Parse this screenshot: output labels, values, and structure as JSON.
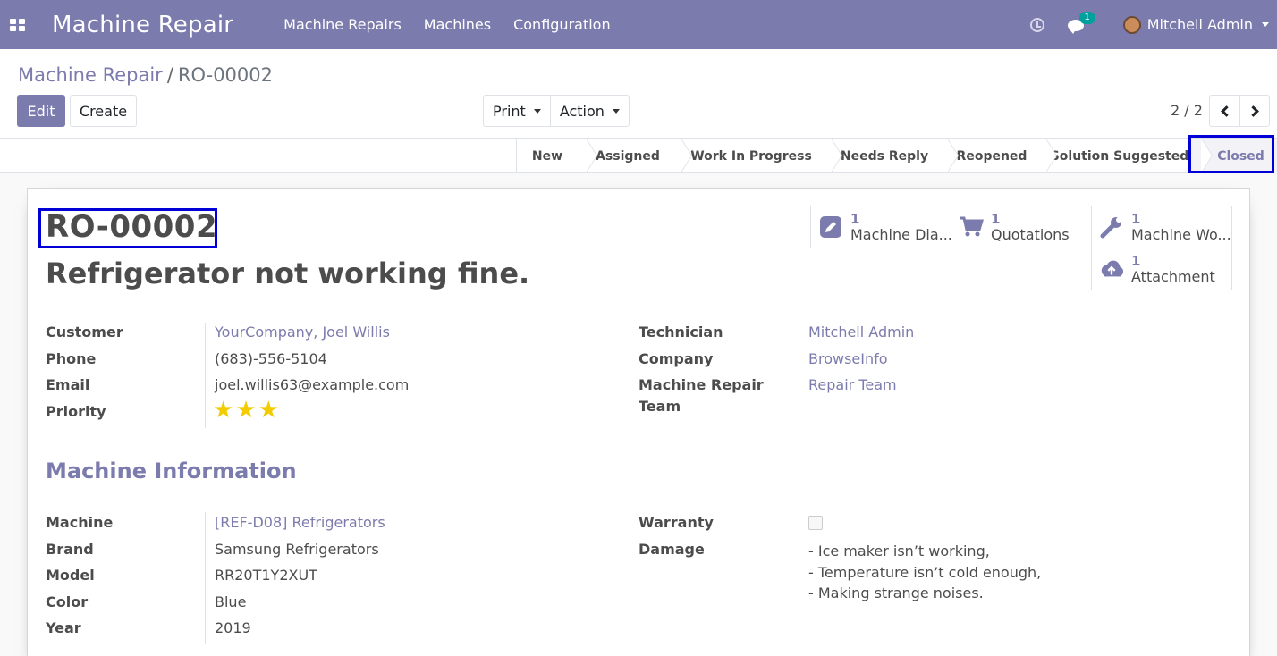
{
  "navbar": {
    "app_title": "Machine Repair",
    "menu": [
      "Machine Repairs",
      "Machines",
      "Configuration"
    ],
    "chat_count": "1",
    "user_name": "Mitchell Admin"
  },
  "breadcrumb": {
    "parent": "Machine Repair",
    "separator": "/",
    "current": "RO-00002"
  },
  "buttons": {
    "edit": "Edit",
    "create": "Create",
    "print": "Print",
    "action": "Action"
  },
  "pager": {
    "value": "2 / 2"
  },
  "stages": [
    "New",
    "Assigned",
    "Work In Progress",
    "Needs Reply",
    "Reopened",
    "Solution Suggested",
    "Closed"
  ],
  "current_stage": "Closed",
  "record": {
    "reference": "RO-00002",
    "title": "Refrigerator not working fine."
  },
  "smart_buttons": [
    {
      "count": "1",
      "label": "Machine Dia...",
      "icon": "pencil-square-icon"
    },
    {
      "count": "1",
      "label": "Quotations",
      "icon": "shopping-cart-icon"
    },
    {
      "count": "1",
      "label": "Machine Wo...",
      "icon": "wrench-icon"
    },
    {
      "count": "1",
      "label": "Attachment",
      "icon": "cloud-upload-icon"
    }
  ],
  "left_fields": {
    "customer_label": "Customer",
    "customer_value": "YourCompany, Joel Willis",
    "phone_label": "Phone",
    "phone_value": "(683)-556-5104",
    "email_label": "Email",
    "email_value": "joel.willis63@example.com",
    "priority_label": "Priority",
    "priority_stars": 3
  },
  "right_fields": {
    "technician_label": "Technician",
    "technician_value": "Mitchell Admin",
    "company_label": "Company",
    "company_value": "BrowseInfo",
    "team_label_1": "Machine Repair",
    "team_label_2": "Team",
    "team_value": "Repair Team"
  },
  "machine_section": {
    "title": "Machine Information",
    "machine_label": "Machine",
    "machine_value": "[REF-D08] Refrigerators",
    "brand_label": "Brand",
    "brand_value": "Samsung Refrigerators",
    "model_label": "Model",
    "model_value": "RR20T1Y2XUT",
    "color_label": "Color",
    "color_value": "Blue",
    "year_label": "Year",
    "year_value": "2019",
    "warranty_label": "Warranty",
    "warranty_checked": false,
    "damage_label": "Damage",
    "damage_lines": [
      "- Ice maker isn’t working,",
      "- Temperature isn’t cold enough,",
      "- Making strange noises."
    ]
  },
  "colors": {
    "brand": "#7c7bad",
    "highlight": "#0000d6",
    "star": "#f3cc00"
  }
}
